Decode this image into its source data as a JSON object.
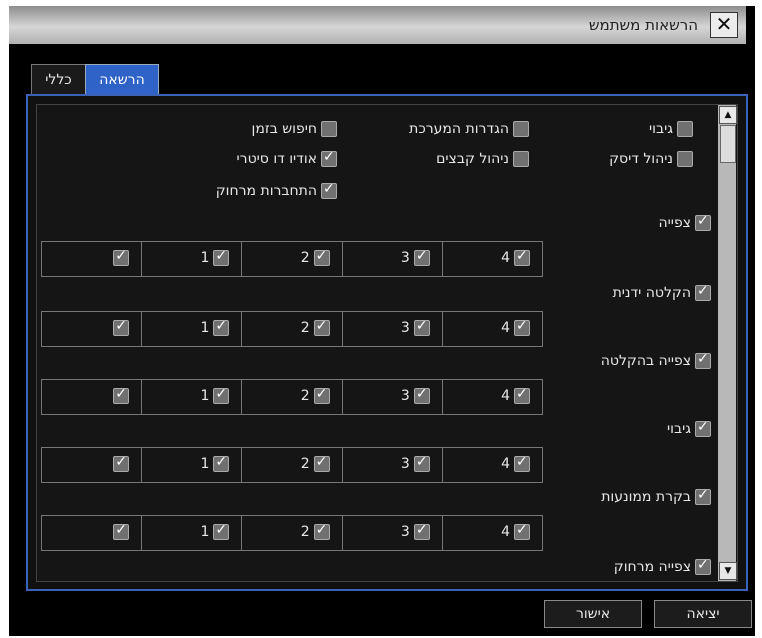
{
  "window": {
    "title": "הרשאות משתמש"
  },
  "tabs": [
    {
      "label": "כללי"
    },
    {
      "label": "הרשאה"
    }
  ],
  "permissions": {
    "backup": "גיבוי",
    "system_settings": "הגדרות המערכת",
    "time_search": "חיפוש בזמן",
    "disk_management": "ניהול דיסק",
    "file_management": "ניהול קבצים",
    "two_way_audio": "אודיו דו סיטרי",
    "remote_connection": "התחברות מרחוק"
  },
  "sections": [
    {
      "label": "צפייה",
      "channels": [
        "",
        "1",
        "2",
        "3",
        "4"
      ]
    },
    {
      "label": "הקלטה ידנית",
      "channels": [
        "",
        "1",
        "2",
        "3",
        "4"
      ]
    },
    {
      "label": "צפייה בהקלטה",
      "channels": [
        "",
        "1",
        "2",
        "3",
        "4"
      ]
    },
    {
      "label": "גיבוי",
      "channels": [
        "",
        "1",
        "2",
        "3",
        "4"
      ]
    },
    {
      "label": "בקרת ממונעות",
      "channels": [
        "",
        "1",
        "2",
        "3",
        "4"
      ]
    },
    {
      "label": "צפייה מרחוק"
    }
  ],
  "buttons": {
    "ok": "אישור",
    "exit": "יציאה"
  }
}
